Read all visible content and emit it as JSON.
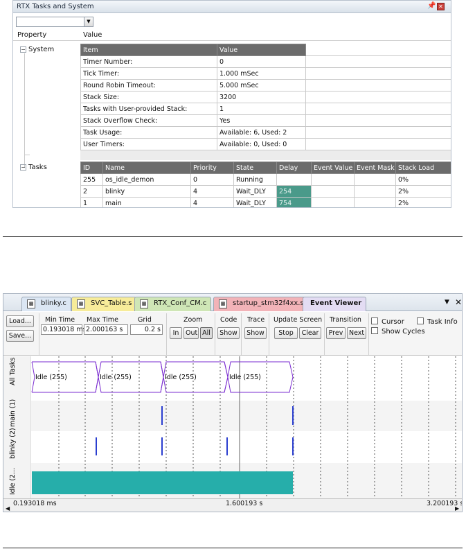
{
  "rtx_panel": {
    "title": "RTX Tasks and System",
    "pin_icon": "pin-icon",
    "close_icon": "close-icon",
    "combo_value": "",
    "property_header": "Property",
    "value_header": "Value",
    "system_node": "System",
    "tasks_node": "Tasks",
    "system_table": {
      "headers": [
        "Item",
        "Value"
      ],
      "rows": [
        [
          "Timer Number:",
          "0"
        ],
        [
          "Tick Timer:",
          "1.000 mSec"
        ],
        [
          "Round Robin Timeout:",
          "5.000 mSec"
        ],
        [
          "Stack Size:",
          "3200"
        ],
        [
          "Tasks with User-provided Stack:",
          "1"
        ],
        [
          "Stack Overflow Check:",
          "Yes"
        ],
        [
          "Task Usage:",
          "Available: 6, Used: 2"
        ],
        [
          "User Timers:",
          "Available: 0, Used: 0"
        ]
      ]
    },
    "tasks_table": {
      "headers": [
        "ID",
        "Name",
        "Priority",
        "State",
        "Delay",
        "Event Value",
        "Event Mask",
        "Stack Load"
      ],
      "rows": [
        [
          "255",
          "os_idle_demon",
          "0",
          "Running",
          "",
          "",
          "",
          "0%"
        ],
        [
          "2",
          "blinky",
          "4",
          "Wait_DLY",
          "254",
          "",
          "",
          "2%"
        ],
        [
          "1",
          "main",
          "4",
          "Wait_DLY",
          "754",
          "",
          "",
          "2%"
        ]
      ],
      "highlight_color": "#4a9a8a"
    }
  },
  "event_viewer": {
    "tabs": [
      {
        "label": "blinky.c",
        "color": "#dbe6f3"
      },
      {
        "label": "SVC_Table.s",
        "color": "#f7ec9a"
      },
      {
        "label": "RTX_Conf_CM.c",
        "color": "#cfe6b6"
      },
      {
        "label": "startup_stm32f4xx.s",
        "color": "#f2b3b8"
      },
      {
        "label": "Event Viewer",
        "color": "#e3dcf3",
        "active": true
      }
    ],
    "toolbar": {
      "load": "Load...",
      "save": "Save...",
      "min_time_label": "Min Time",
      "min_time": "0.193018 ms",
      "max_time_label": "Max Time",
      "max_time": "2.000163 s",
      "grid_label": "Grid",
      "grid": "0.2 s",
      "zoom_label": "Zoom",
      "zoom_in": "In",
      "zoom_out": "Out",
      "zoom_all": "All",
      "code_label": "Code",
      "code_show": "Show",
      "trace_label": "Trace",
      "trace_show": "Show",
      "update_label": "Update Screen",
      "stop": "Stop",
      "clear": "Clear",
      "transition_label": "Transition",
      "prev": "Prev",
      "next": "Next",
      "cursor": "Cursor",
      "show_cycles": "Show Cycles",
      "task_info": "Task Info"
    },
    "rows": [
      "All Tasks",
      "main (1)",
      "blinky (2)",
      "Idle (2..."
    ],
    "idle_label": "Idle (255)",
    "axis": {
      "left": "0.193018 ms",
      "mid": "1.600193 s",
      "right": "3.200193 s"
    },
    "colors": {
      "idle_fill": "#26aeaa",
      "event_tick": "#2a3ecf",
      "envelope": "#7a2bd0"
    }
  }
}
